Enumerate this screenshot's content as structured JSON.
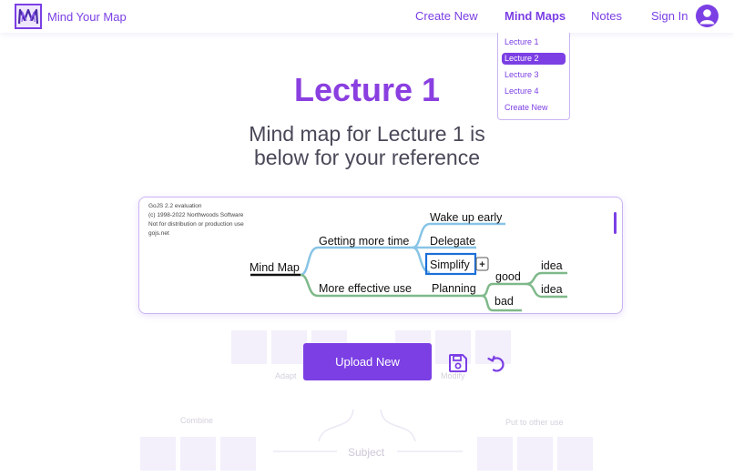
{
  "header": {
    "brand": "Mind Your Map",
    "nav": [
      {
        "label": "Create New"
      },
      {
        "label": "Mind Maps"
      },
      {
        "label": "Notes"
      },
      {
        "label": "Sign In"
      }
    ],
    "dropdown": [
      "Lecture 1",
      "Lecture 2",
      "Lecture 3",
      "Lecture 4",
      "Create New"
    ],
    "dropdown_selected": "Lecture 2"
  },
  "main": {
    "title": "Lecture 1",
    "subtitle_line1": "Mind map for Lecture 1 is",
    "subtitle_line2": "below for your reference"
  },
  "diagram": {
    "eval_lines": [
      "GoJS 2.2 evaluation",
      "(c) 1998-2022 Northwoods Software",
      "Not for distribution or production use",
      "gojs.net"
    ],
    "nodes": {
      "root": "Mind Map",
      "more_time": "Getting more time",
      "wake_up": "Wake up early",
      "delegate": "Delegate",
      "simplify": "Simplify",
      "effective": "More effective use",
      "planning": "Planning",
      "good": "good",
      "bad": "bad",
      "idea1": "idea",
      "idea2": "idea"
    },
    "add_button": "+"
  },
  "actions": {
    "upload_label": "Upload New"
  },
  "background": {
    "labels": [
      "Adapt",
      "Modify",
      "Combine",
      "Put to other use"
    ],
    "subject": "Subject"
  },
  "colors": {
    "accent": "#7b3fe4",
    "blue_branch": "#88c4e6",
    "green_branch": "#7fb98a",
    "selection": "#1c6fd8"
  }
}
